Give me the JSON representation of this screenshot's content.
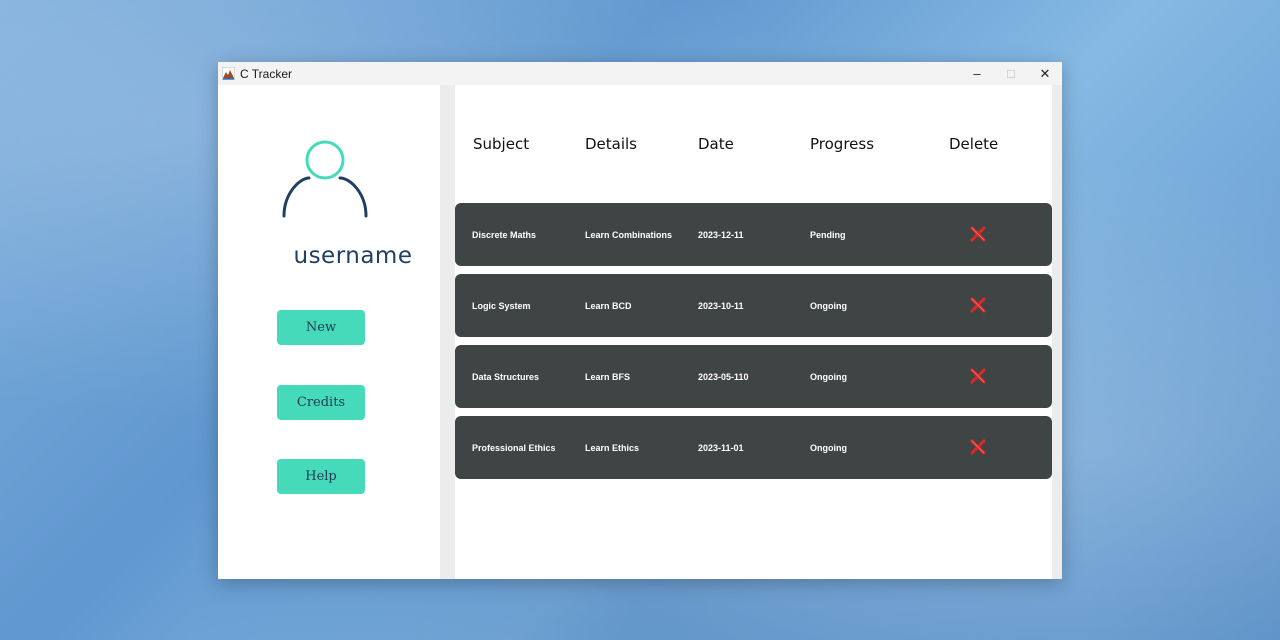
{
  "window": {
    "title": "C Tracker",
    "controls": {
      "minimize": "–",
      "maximize": "□",
      "close": "✕"
    }
  },
  "sidebar": {
    "username": "username",
    "buttons": {
      "new": "New",
      "credits": "Credits",
      "help": "Help"
    },
    "accent_color": "#45dab9",
    "avatar_head_color": "#45dab9",
    "avatar_body_color": "#1f3f63"
  },
  "table": {
    "headers": {
      "subject": "Subject",
      "details": "Details",
      "date": "Date",
      "progress": "Progress",
      "delete": "Delete"
    },
    "row_color": "#3f4444",
    "rows": [
      {
        "subject": "Discrete Maths",
        "details": "Learn Combinations",
        "date": "2023-12-11",
        "progress": "Pending",
        "delete_icon": "red-x-icon"
      },
      {
        "subject": "Logic System",
        "details": "Learn BCD",
        "date": "2023-10-11",
        "progress": "Ongoing",
        "delete_icon": "red-x-icon"
      },
      {
        "subject": "Data Structures",
        "details": "Learn BFS",
        "date": "2023-05-110",
        "progress": "Ongoing",
        "delete_icon": "red-x-icon"
      },
      {
        "subject": "Professional Ethics",
        "details": "Learn Ethics",
        "date": "2023-11-01",
        "progress": "Ongoing",
        "delete_icon": "red-x-icon"
      }
    ]
  }
}
